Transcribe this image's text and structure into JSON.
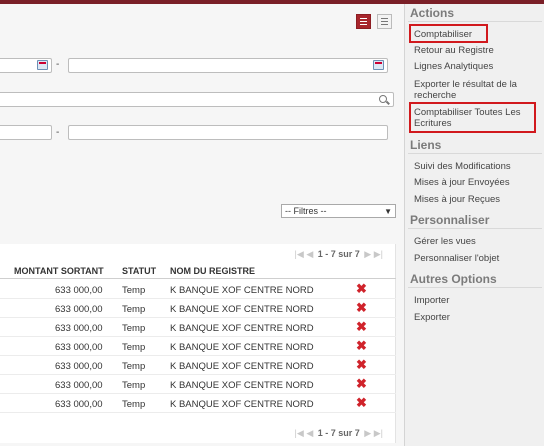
{
  "toolbar": {
    "view_list": "list-view-icon",
    "view_grid": "grid-view-icon"
  },
  "filters": {
    "dash1": "-",
    "dash2": "-",
    "select_value": "-- Filtres --"
  },
  "pager_top": {
    "text": "1 - 7 sur 7"
  },
  "pager_bottom": {
    "text": "1 - 7 sur 7"
  },
  "table": {
    "headers": [
      "MONTANT SORTANT",
      "STATUT",
      "NOM DU REGISTRE"
    ],
    "rows": [
      [
        "633 000,00",
        "Temp",
        "K BANQUE XOF CENTRE NORD"
      ],
      [
        "633 000,00",
        "Temp",
        "K BANQUE XOF CENTRE NORD"
      ],
      [
        "633 000,00",
        "Temp",
        "K BANQUE XOF CENTRE NORD"
      ],
      [
        "633 000,00",
        "Temp",
        "K BANQUE XOF CENTRE NORD"
      ],
      [
        "633 000,00",
        "Temp",
        "K BANQUE XOF CENTRE NORD"
      ],
      [
        "633 000,00",
        "Temp",
        "K BANQUE XOF CENTRE NORD"
      ],
      [
        "633 000,00",
        "Temp",
        "K BANQUE XOF CENTRE NORD"
      ]
    ]
  },
  "sidebar": {
    "actions_title": "Actions",
    "actions": [
      "Comptabiliser",
      "Retour au Registre",
      "Lignes Analytiques",
      "Exporter le résultat de la",
      "recherche",
      "Comptabiliser Toutes Les",
      "Ecritures"
    ],
    "liens_title": "Liens",
    "liens": [
      "Suivi des Modifications",
      "Mises à jour Envoyées",
      "Mises à jour Reçues"
    ],
    "perso_title": "Personnaliser",
    "perso": [
      "Gérer les vues",
      "Personnaliser l'objet"
    ],
    "autres_title": "Autres Options",
    "autres": [
      "Importer",
      "Exporter"
    ]
  },
  "colors": {
    "brand": "#7a1f27",
    "highlight": "#d1191d",
    "delete": "#d0232b"
  }
}
